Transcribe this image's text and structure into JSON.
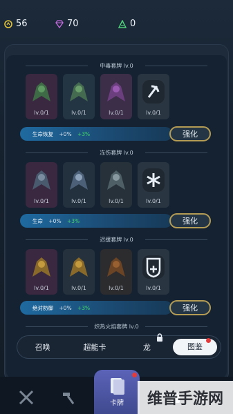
{
  "resources": {
    "coins": "56",
    "gems": "70",
    "tokens": "0"
  },
  "sets": [
    {
      "title": "中毒套牌 lv.0",
      "cards": [
        "lv.0/1",
        "lv.0/1",
        "lv.0/1",
        "lv.0/1"
      ],
      "bonus": {
        "stat": "生命恢复",
        "current": "+0%",
        "next": "+3%"
      },
      "upgrade_label": "强化",
      "theme": "poison"
    },
    {
      "title": "冻伤套牌 lv.0",
      "cards": [
        "lv.0/1",
        "lv.0/1",
        "lv.0/1",
        "lv.0/1"
      ],
      "bonus": {
        "stat": "生命",
        "current": "+0%",
        "next": "+3%"
      },
      "upgrade_label": "强化",
      "theme": "frost"
    },
    {
      "title": "迟缓套牌 lv.0",
      "cards": [
        "lv.0/1",
        "lv.0/1",
        "lv.0/1",
        "lv.0/1"
      ],
      "bonus": {
        "stat": "绝对防御",
        "current": "+0%",
        "next": "+3%"
      },
      "upgrade_label": "强化",
      "theme": "slow"
    }
  ],
  "next_set_title": "炽热火焰套牌 lv.0",
  "tabs": [
    "召唤",
    "超能卡",
    "龙",
    "图鉴"
  ],
  "active_tab": "图鉴",
  "bottom_nav": {
    "active_label": "卡牌"
  },
  "watermark": "维普手游网",
  "colors": {
    "accent_gold": "#b59c55",
    "bonus_green": "#45d66b",
    "bar_blue": "#1e6aa0"
  }
}
